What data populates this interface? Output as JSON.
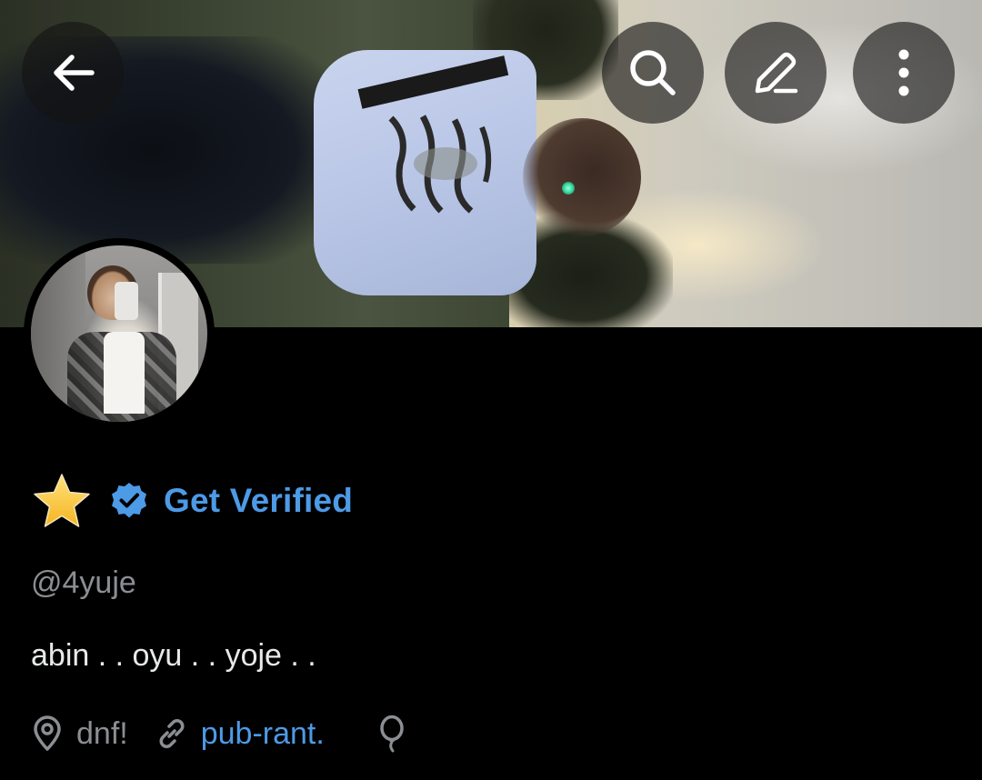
{
  "header": {
    "back_icon": "arrow-left-icon",
    "search_icon": "search-icon",
    "edit_icon": "pencil-icon",
    "more_icon": "more-vertical-icon"
  },
  "profile": {
    "display_name_emoji": "star-emoji",
    "badge_icon": "verified-badge-icon",
    "get_verified_label": "Get Verified",
    "handle": "@4yuje",
    "bio": "abin . . oyu . . yoje . .",
    "location": "dnf!",
    "location_icon": "location-pin-icon",
    "link_icon": "link-icon",
    "link_text": "pub-rant.",
    "birthday_icon": "balloon-icon"
  },
  "colors": {
    "background": "#000000",
    "accent": "#4d9ae6",
    "muted_text": "#8b8e92",
    "primary_text": "#e7e9ea",
    "button_overlay": "rgba(20,20,20,0.62)"
  }
}
